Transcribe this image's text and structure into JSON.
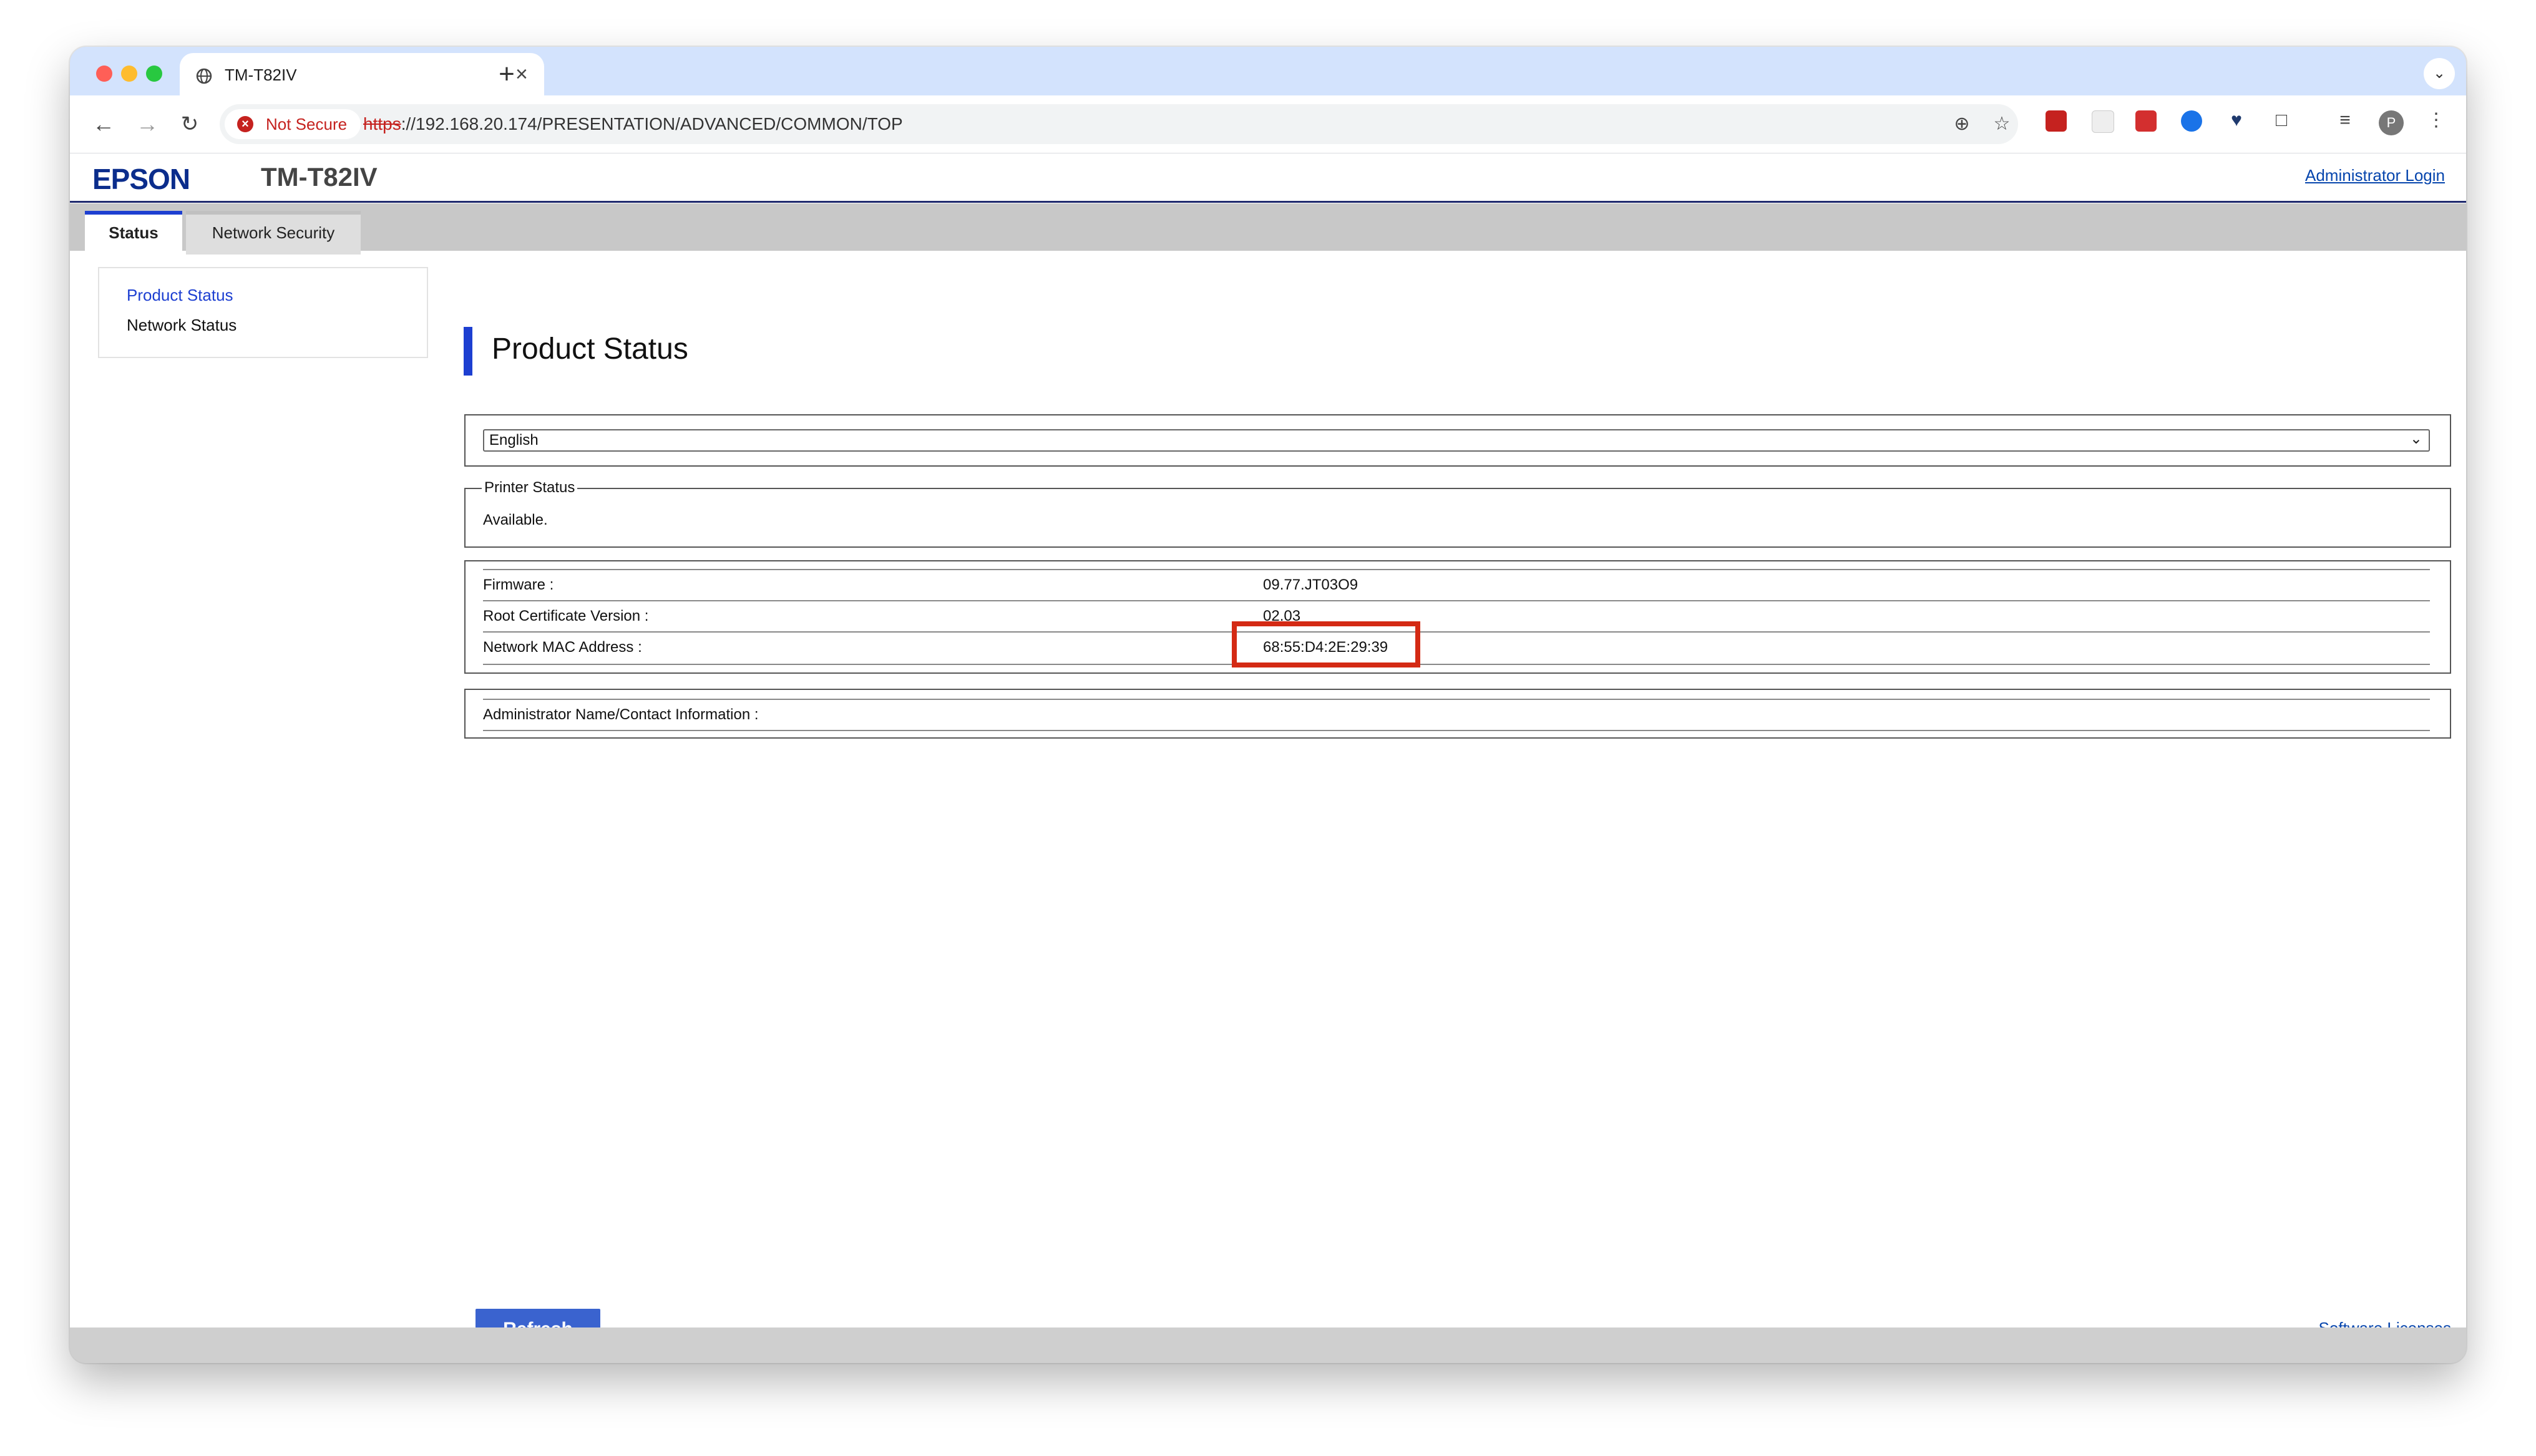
{
  "browser": {
    "tab_title": "TM-T82IV",
    "new_tab": "+",
    "tab_close": "×",
    "security_label": "Not Secure",
    "url_scheme": "https",
    "url_rest": "://192.168.20.174/PRESENTATION/ADVANCED/COMMON/TOP",
    "icons": [
      "back-icon",
      "forward-icon",
      "reload-icon",
      "zoom-icon",
      "star-icon",
      "extension-icon",
      "profile-icon",
      "menu-icon"
    ],
    "profile_initial": "P"
  },
  "header": {
    "brand": "EPSON",
    "model": "TM-T82IV",
    "admin_login": "Administrator Login"
  },
  "tabs": [
    {
      "label": "Status",
      "active": true
    },
    {
      "label": "Network Security",
      "active": false
    }
  ],
  "sidebar": {
    "items": [
      {
        "label": "Product Status",
        "current": true
      },
      {
        "label": "Network Status",
        "current": false
      }
    ]
  },
  "main": {
    "title": "Product Status",
    "language": {
      "selected": "English"
    },
    "printer_status": {
      "legend": "Printer Status",
      "value": "Available."
    },
    "info": [
      {
        "label": "Firmware :",
        "value": "09.77.JT03O9"
      },
      {
        "label": "Root Certificate Version :",
        "value": "02.03"
      },
      {
        "label": "Network MAC Address :",
        "value": "68:55:D4:2E:29:39"
      }
    ],
    "admin_contact": {
      "label": "Administrator Name/Contact Information :"
    },
    "refresh": "Refresh",
    "software_licenses": "Software Licenses"
  },
  "colors": {
    "accent": "#1d3fd1",
    "highlight": "#d42a14",
    "tabstrip": "#d3e3fd",
    "button": "#3a63cf"
  }
}
